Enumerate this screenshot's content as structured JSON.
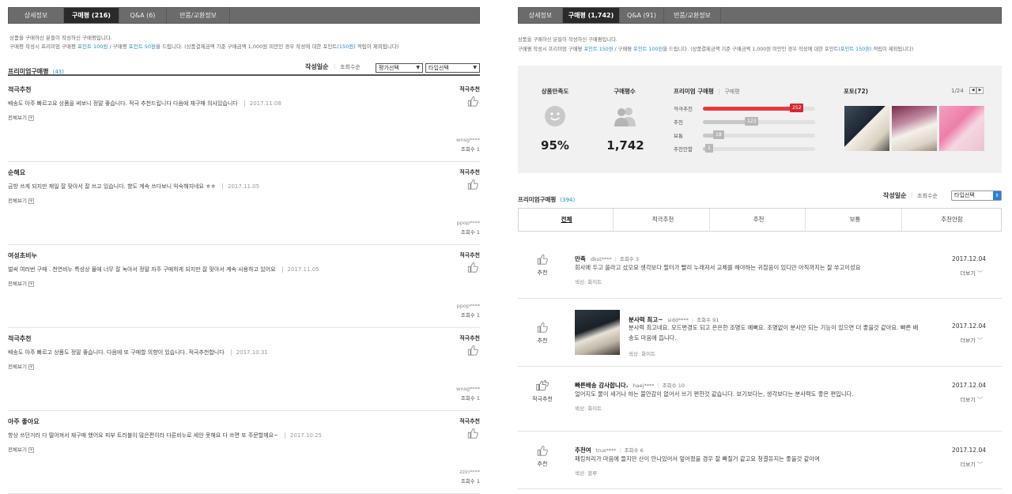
{
  "left": {
    "tabs": [
      "상세정보",
      "구매평 (216)",
      "Q&A (6)",
      "반품/교환정보"
    ],
    "notice_line1": "상품을 구매하신 분들이 작성하신 구매평입니다.",
    "notice_line2_a": "구매평 작성시 프리미엄 구매평 ",
    "notice_line2_b": "포인트 100원",
    "notice_line2_c": " / 구매평 ",
    "notice_line2_d": "포인트 50원",
    "notice_line2_e": "을 드립니다. (상품결제금액 기준 구매금액 1,000원 미만인 경우 작성에 대한 포인트",
    "notice_line2_f": "(150원)",
    "notice_line2_g": " 적립이 제외됩니다)",
    "section_title": "프리미엄구매평",
    "section_count": "(43)",
    "sort_active": "작성일순",
    "sort_views": "조회수순",
    "select_rating": "평가선택",
    "select_type": "타입선택",
    "reviews": [
      {
        "title": "적극추천",
        "badge": "적극추천",
        "text": "배송도 아주 빠르고요 상품을 써보니 정말 좋습니다. 적극 추천드립니다 다음에 재구매 의사있습니다",
        "date": "2017.11.08",
        "more": "전체보기",
        "user": "wnsg****",
        "views": "조회수 1"
      },
      {
        "title": "순해요",
        "badge": "적극추천",
        "text": "금방 쓰게 되지만 제일 잘 맞아서 잘 쓰고 있습니다. 향도 계속 쓰다보니 익숙해지네요 ㅎㅎ",
        "date": "2017.11.05",
        "more": "전체보기",
        "user": "ppop****",
        "views": "조회수 1"
      },
      {
        "title": "여성초비누",
        "badge": "적극추천",
        "text": "벌써 여러번 구매 . 천연비누 특성상 물에 너무 잘 녹아서 정말 자주 구매하게 되지만 잘 맞아서 계속 사용하고 있어요",
        "date": "2017.11.05",
        "more": "전체보기",
        "user": "ppop****",
        "views": "조회수 1"
      },
      {
        "title": "적극추천",
        "badge": "적극추천",
        "text": "배송도 아주 빠르고 상품도 정말 좋습니다. 다음에 또 구매할 의향이 있습니다. 적극추천합니다",
        "date": "2017.10.31",
        "more": "전체보기",
        "user": "wnsg****",
        "views": "조회수 1"
      },
      {
        "title": "아주 좋아요",
        "badge": "적극추천",
        "text": "항상 쓰던거라 다 떨어져서 재구매 했어요 피부 트러블이 많은편이라 다른비누로 세안 못해요 다 쓰면 또 주문할께요~",
        "date": "2017.10.25",
        "more": "전체보기",
        "user": "zzin****",
        "views": "조회수 1"
      }
    ]
  },
  "right": {
    "tabs": [
      "상세정보",
      "구매평 (1,742)",
      "Q&A (91)",
      "반품/교환정보"
    ],
    "notice_line1": "상품을 구매하신 분들이 작성하신 구매평입니다.",
    "notice_line2_a": "구매평 작성시 프리미엄 구매평 ",
    "notice_line2_b": "포인트 150원",
    "notice_line2_c": " / 구매평 ",
    "notice_line2_d": "포인트 100원",
    "notice_line2_e": "을 드립니다. (상품결제금액 기준 구매금액 1,000원 미만인 경우 작성에 대한 포인트",
    "notice_line2_f": "(포인트 150원)",
    "notice_line2_g": " 적립이 제외됩니다)",
    "summary": {
      "satisfaction_label": "상품만족도",
      "satisfaction_value": "95%",
      "reviewer_label": "구매평수",
      "reviewer_value": "1,742",
      "dist_title": "프리미엄 구매평",
      "dist_sub": "구매평",
      "dist": [
        {
          "label": "적극추천",
          "count": "252",
          "ratio": 0.8,
          "highlight": true
        },
        {
          "label": "추천",
          "count": "123",
          "ratio": 0.4,
          "highlight": false
        },
        {
          "label": "보통",
          "count": "18",
          "ratio": 0.12,
          "highlight": false
        },
        {
          "label": "추천안함",
          "count": "1",
          "ratio": 0.05,
          "highlight": false
        }
      ],
      "photo_label": "포토(72)",
      "photo_page": "1/24"
    },
    "section_title": "프리미엄구매평",
    "section_count": "(394)",
    "sort_active": "작성일순",
    "sort_views": "조회수순",
    "select_type": "타입선택",
    "filters": [
      "전체",
      "적극추천",
      "추천",
      "보통",
      "추천안함"
    ],
    "reviews": [
      {
        "rating": "추천",
        "title": "만족",
        "user": "dkst****",
        "views": "조회수 3",
        "text": "회사에 두고 쓸라고 샀오요 생각보다 필터가 빨리 누래져서 교체를 해야하는 귀찮음이 있디만 아직까지는 잘 쑤고이성요",
        "option": "색상: 화이트",
        "date": "2017.12.04",
        "more": "더보기"
      },
      {
        "rating": "추천",
        "title": "분사력 최고~",
        "user": "sidd****",
        "views": "조회수 91",
        "text": "분사력 최고네요. 모드변경도 되고 은은한 조명도 예뻐요. 조명없이 분사만 되는 기능이 있으면 더 좋을것 같아요. 빠른 배송도 마음에 듭니다.",
        "option": "색상: 화이트",
        "date": "2017.12.04",
        "more": "더보기"
      },
      {
        "rating": "적극추천",
        "title": "빠른배송 감사합니다.",
        "user": "haej****",
        "views": "조회수 10",
        "text": "얼어지도 물이 새거나 하는 불안감이 없어서 쓰기 편한것 같습니다. 보기보다는, 생각보다는 분사력도 좋은 편입니다.",
        "option": "색상: 화이트",
        "date": "2017.12.04",
        "more": "더보기"
      },
      {
        "rating": "추천",
        "title": "추천여",
        "user": "trus****",
        "views": "조회수 6",
        "text": "패킹처리가 마음에 들지만 산이 안나있어서 엎어졌을 경우 잘 빠질거 같고요 청결유지는 좋을것 같아여",
        "option": "색상: 블루",
        "date": "2017.12.04",
        "more": "더보기"
      }
    ]
  },
  "colors": {
    "accent": "#1e8ac8",
    "highlight": "#e8383d",
    "tab_active": "#2a2a2a"
  }
}
